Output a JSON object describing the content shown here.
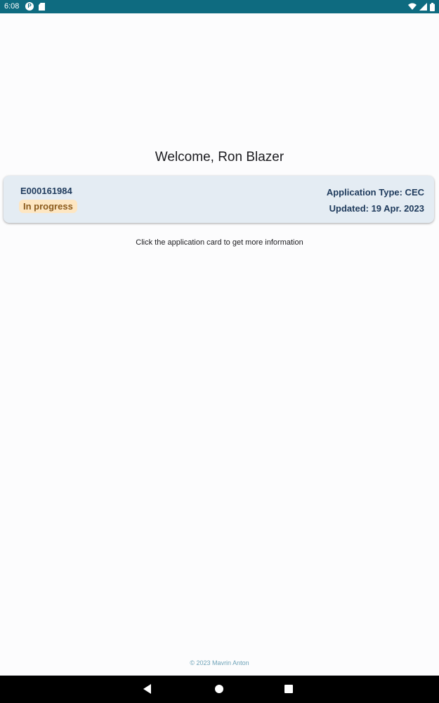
{
  "status_bar": {
    "time": "6:08",
    "app_icon_letter": "P",
    "icons": [
      "wifi-icon",
      "signal-icon",
      "battery-icon"
    ],
    "background_color": "#0e6b80"
  },
  "main": {
    "welcome": "Welcome, Ron Blazer",
    "card": {
      "id": "E000161984",
      "status": "In progress",
      "type": "Application Type: CEC",
      "updated": "Updated: 19 Apr. 2023"
    },
    "hint": "Click the application card to get more information",
    "footer": "© 2023 Mavrin Anton"
  },
  "nav_bar": {
    "buttons": [
      "back-icon",
      "home-icon",
      "recents-icon"
    ]
  },
  "colors": {
    "card_bg": "#e4ecf3",
    "badge_bg": "#fde6c2",
    "badge_text": "#8a5a1c",
    "card_text": "#1e3a5c"
  }
}
